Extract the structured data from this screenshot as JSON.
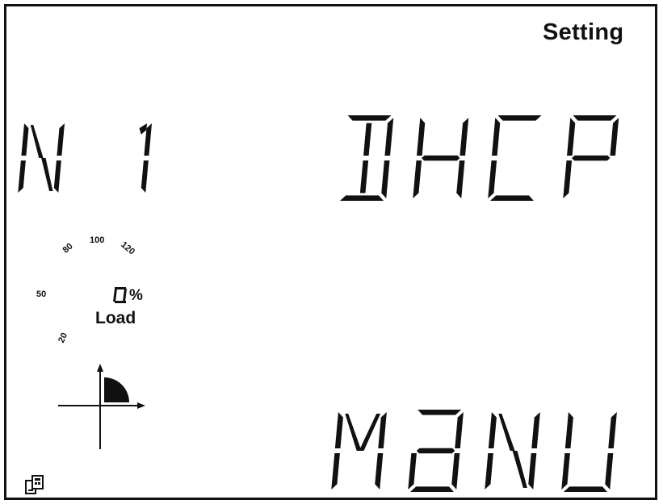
{
  "header": {
    "mode_label": "Setting"
  },
  "display": {
    "left_code": "N1",
    "top_text": "DHCP",
    "bottom_text": "MANU"
  },
  "load": {
    "scale_labels": [
      "20",
      "50",
      "80",
      "100",
      "120"
    ],
    "value_digit": "0",
    "unit": "%",
    "label": "Load"
  },
  "icons": [
    "quadrant-indicator-icon",
    "communication-icon"
  ]
}
